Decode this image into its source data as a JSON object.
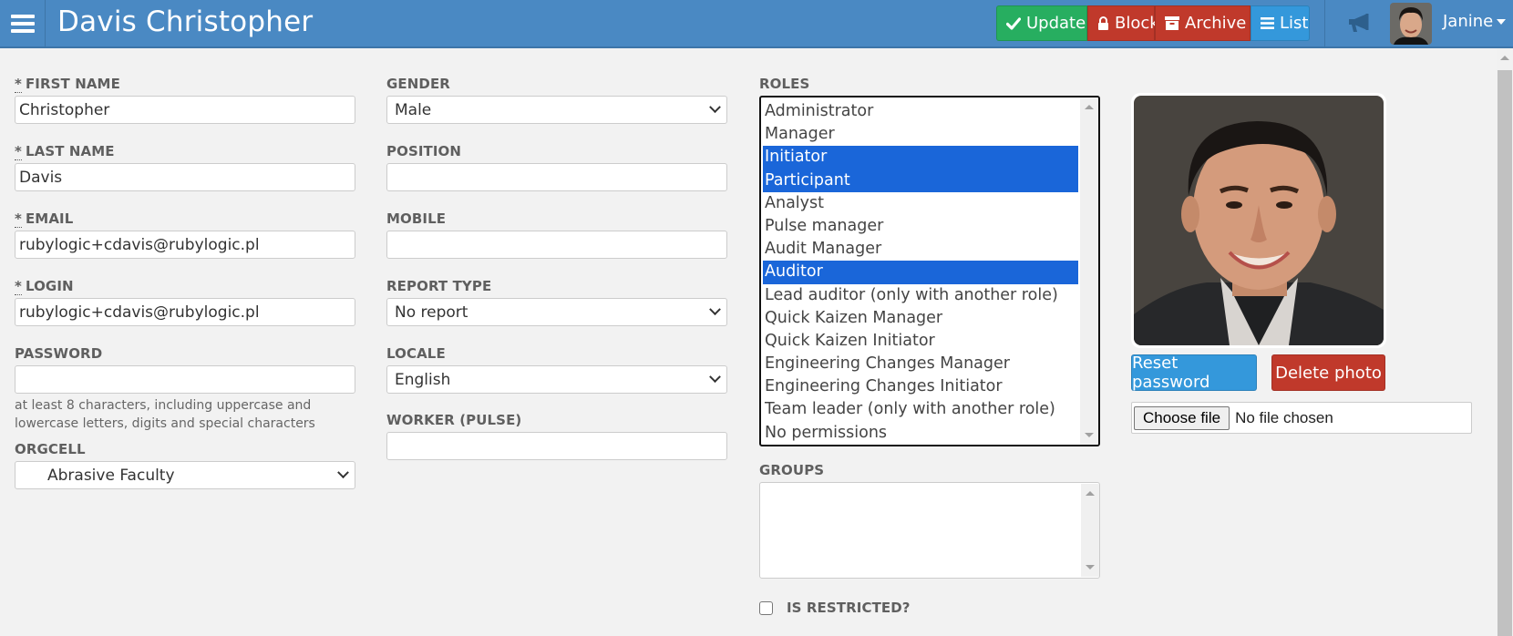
{
  "header": {
    "title": "Davis Christopher",
    "buttons": {
      "update": "Update",
      "block": "Block",
      "archive": "Archive",
      "list": "List"
    },
    "user_name": "Janine"
  },
  "form": {
    "first_name": {
      "label": "FIRST NAME",
      "required": "*",
      "value": "Christopher"
    },
    "last_name": {
      "label": "LAST NAME",
      "required": "*",
      "value": "Davis"
    },
    "email": {
      "label": "EMAIL",
      "required": "*",
      "value": "rubylogic+cdavis@rubylogic.pl"
    },
    "login": {
      "label": "LOGIN",
      "required": "*",
      "value": "rubylogic+cdavis@rubylogic.pl"
    },
    "password": {
      "label": "PASSWORD",
      "value": "",
      "hint": "at least 8 characters, including uppercase and lowercase letters, digits and special characters"
    },
    "orgcell": {
      "label": "ORGCELL",
      "value": "Abrasive Faculty"
    },
    "gender": {
      "label": "GENDER",
      "value": "Male"
    },
    "position": {
      "label": "POSITION",
      "value": ""
    },
    "mobile": {
      "label": "MOBILE",
      "value": ""
    },
    "report_type": {
      "label": "REPORT TYPE",
      "value": "No report"
    },
    "locale": {
      "label": "LOCALE",
      "value": "English"
    },
    "worker_pulse": {
      "label": "WORKER (PULSE)",
      "value": ""
    },
    "roles": {
      "label": "ROLES",
      "options": [
        {
          "label": "Administrator",
          "selected": false
        },
        {
          "label": "Manager",
          "selected": false
        },
        {
          "label": "Initiator",
          "selected": true
        },
        {
          "label": "Participant",
          "selected": true
        },
        {
          "label": "Analyst",
          "selected": false
        },
        {
          "label": "Pulse manager",
          "selected": false
        },
        {
          "label": "Audit Manager",
          "selected": false
        },
        {
          "label": "Auditor",
          "selected": true
        },
        {
          "label": "Lead auditor (only with another role)",
          "selected": false
        },
        {
          "label": "Quick Kaizen Manager",
          "selected": false
        },
        {
          "label": "Quick Kaizen Initiator",
          "selected": false
        },
        {
          "label": "Engineering Changes Manager",
          "selected": false
        },
        {
          "label": "Engineering Changes Initiator",
          "selected": false
        },
        {
          "label": "Team leader (only with another role)",
          "selected": false
        },
        {
          "label": "No permissions",
          "selected": false
        }
      ]
    },
    "groups": {
      "label": "GROUPS",
      "options": []
    },
    "is_restricted": {
      "label": "IS RESTRICTED?",
      "checked": false
    }
  },
  "photo": {
    "reset_password": "Reset password",
    "delete_photo": "Delete photo",
    "choose_file": "Choose file",
    "no_file": "No file chosen"
  },
  "colors": {
    "header_bg": "#4a89c3",
    "update": "#27ae60",
    "danger": "#c0392b",
    "info": "#3498db",
    "selection": "#1a66d9"
  }
}
